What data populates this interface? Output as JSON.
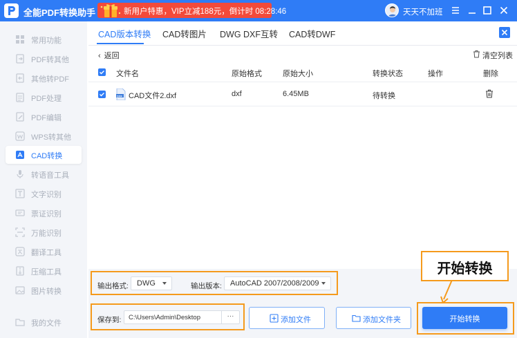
{
  "app": {
    "title": "全能PDF转换助手",
    "promo": "新用户特惠，VIP立减188元，倒计时 08:28:46",
    "username": "天天不加班",
    "brand_color": "#2f7cf6",
    "icons": [
      "logo-icon",
      "gift-icon",
      "avatar",
      "menu-icon",
      "minimize-icon",
      "maximize-icon",
      "close-icon"
    ]
  },
  "sidebar": {
    "items": [
      {
        "label": "常用功能",
        "icon": "grid-icon"
      },
      {
        "label": "PDF转其他",
        "icon": "pdf-export-icon"
      },
      {
        "label": "其他转PDF",
        "icon": "pdf-import-icon"
      },
      {
        "label": "PDF处理",
        "icon": "pdf-process-icon"
      },
      {
        "label": "PDF编辑",
        "icon": "pdf-edit-icon"
      },
      {
        "label": "WPS转其他",
        "icon": "wps-icon"
      },
      {
        "label": "CAD转换",
        "icon": "cad-icon",
        "active": true
      },
      {
        "label": "转语音工具",
        "icon": "voice-icon"
      },
      {
        "label": "文字识别",
        "icon": "ocr-icon"
      },
      {
        "label": "票证识别",
        "icon": "ticket-icon"
      },
      {
        "label": "万能识别",
        "icon": "scan-icon"
      },
      {
        "label": "翻译工具",
        "icon": "translate-icon"
      },
      {
        "label": "压缩工具",
        "icon": "compress-icon"
      },
      {
        "label": "图片转换",
        "icon": "image-icon"
      },
      {
        "label": "我的文件",
        "icon": "folder-icon"
      }
    ]
  },
  "tabs": [
    "CAD版本转换",
    "CAD转图片",
    "DWG DXF互转",
    "CAD转DWF"
  ],
  "toolbar": {
    "back": "返回",
    "clear": "清空列表"
  },
  "table": {
    "headers": [
      "文件名",
      "原始格式",
      "原始大小",
      "转换状态",
      "操作",
      "删除"
    ],
    "rows": [
      {
        "name": "CAD文件2.dxf",
        "format": "dxf",
        "size": "6.45MB",
        "status": "待转换",
        "icon": "dxf-file-icon"
      }
    ]
  },
  "options": {
    "format_label": "输出格式:",
    "format_value": "DWG",
    "version_label": "输出版本:",
    "version_value": "AutoCAD 2007/2008/2009",
    "save_label": "保存到:",
    "save_path": "C:\\Users\\Admin\\Desktop",
    "browse": "···",
    "add_file": "添加文件",
    "add_folder": "添加文件夹",
    "start": "开始转换"
  },
  "annotation": {
    "callout": "开始转换",
    "color": "#f59a1c"
  }
}
